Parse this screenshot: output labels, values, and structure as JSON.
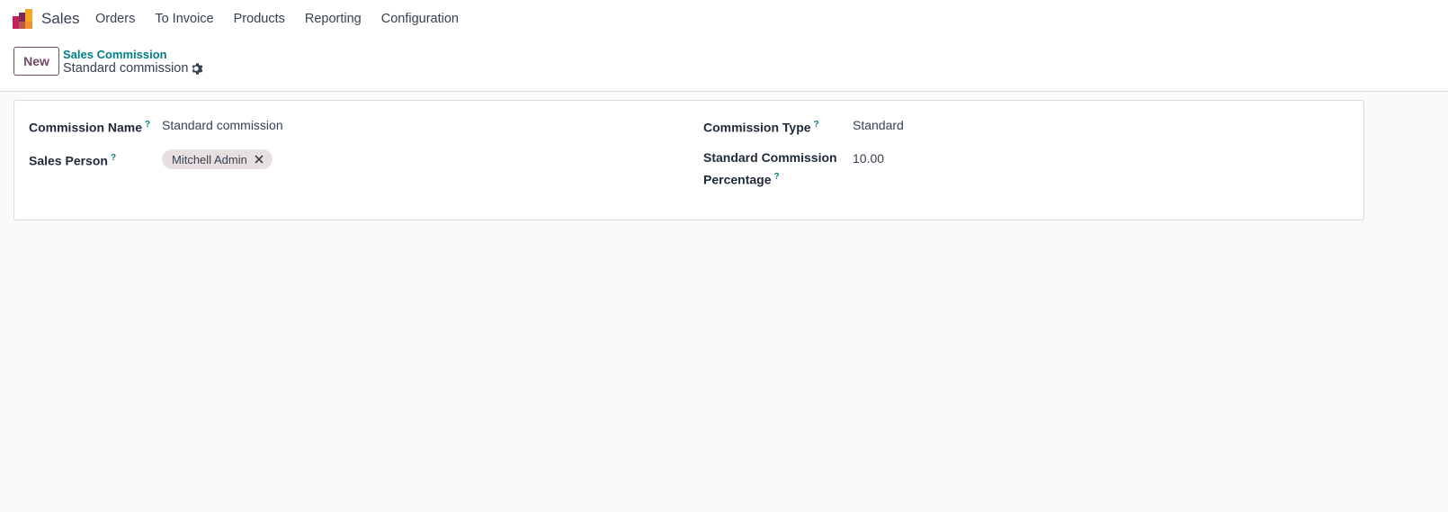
{
  "app": {
    "name": "Sales"
  },
  "menu": {
    "items": [
      {
        "label": "Orders"
      },
      {
        "label": "To Invoice"
      },
      {
        "label": "Products"
      },
      {
        "label": "Reporting"
      },
      {
        "label": "Configuration"
      }
    ]
  },
  "control": {
    "new_label": "New",
    "breadcrumb": "Sales Commission",
    "record_title": "Standard commission"
  },
  "form": {
    "commission_name": {
      "label": "Commission Name",
      "help": "?",
      "value": "Standard commission"
    },
    "sales_person": {
      "label": "Sales Person",
      "help": "?",
      "tags": [
        {
          "label": "Mitchell Admin"
        }
      ]
    },
    "commission_type": {
      "label": "Commission Type",
      "help": "?",
      "value": "Standard"
    },
    "standard_percentage": {
      "label_line1": "Standard Commission",
      "label_line2": "Percentage",
      "help": "?",
      "value": "10.00"
    }
  },
  "colors": {
    "brand": "#714b67",
    "link": "#017e84",
    "tag_bg": "#e8dfe1"
  },
  "icons": {
    "app_logo": "sales-bars-icon",
    "gear": "gear-icon",
    "tag_remove": "close-icon"
  }
}
